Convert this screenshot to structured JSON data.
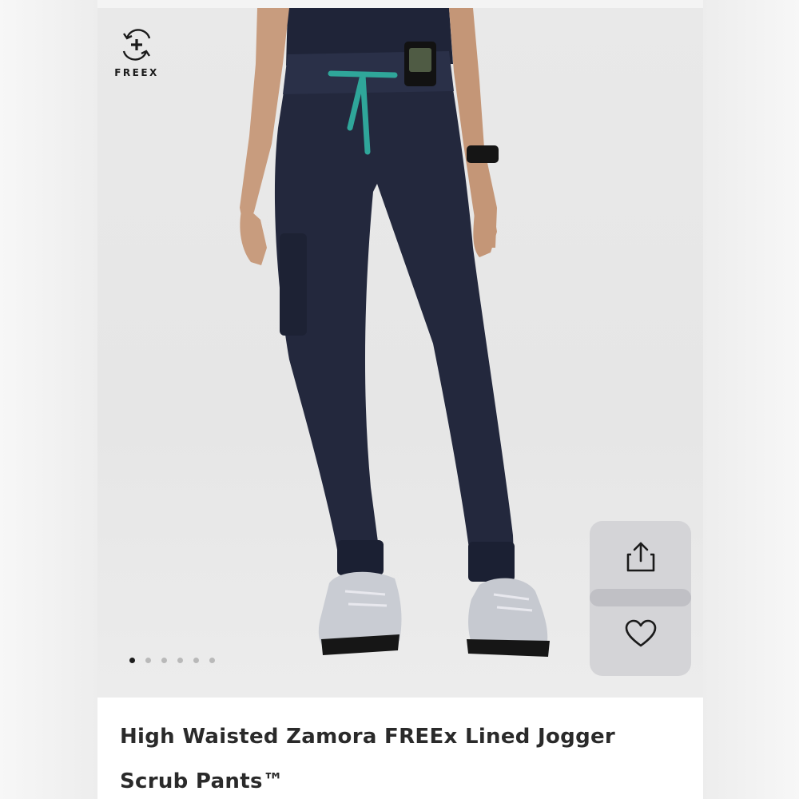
{
  "brand": {
    "name": "FREEX",
    "icon": "freex-logo-icon"
  },
  "product": {
    "title": "High Waisted Zamora FREEx Lined Jogger Scrub Pants™"
  },
  "gallery": {
    "image_count": 6,
    "active_index": 0
  },
  "actions": {
    "share_icon": "share-icon",
    "favorite_icon": "heart-icon"
  },
  "colors": {
    "pants": "#23283d",
    "drawstring": "#2fa69a",
    "background": "#e8e8e8",
    "title_text": "#2a2a2a"
  }
}
